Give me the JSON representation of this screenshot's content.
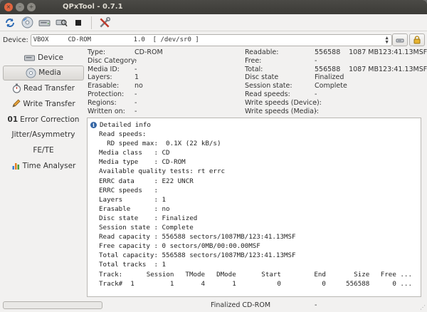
{
  "window": {
    "title": "QPxTool - 0.7.1"
  },
  "toolbar": {
    "icons": [
      "refresh-icon",
      "disc-icon",
      "drive-icon",
      "drive-search-icon",
      "stop-icon",
      "tools-icon"
    ]
  },
  "device": {
    "label": "Device:",
    "selected": "VBOX     CD-ROM           1.0  [ /dev/sr0 ]"
  },
  "sidebar": {
    "items": [
      {
        "label": "Device",
        "icon": "drive-icon"
      },
      {
        "label": "Media",
        "icon": "disc-icon"
      },
      {
        "label": "Read Transfer",
        "icon": "stopwatch-icon"
      },
      {
        "label": "Write Transfer",
        "icon": "pencil-icon"
      },
      {
        "label": "Error Correction",
        "prefix": "01"
      },
      {
        "label": "Jitter/Asymmetry"
      },
      {
        "label": "FE/TE"
      },
      {
        "label": "Time Analyser",
        "icon": "bar-chart-icon"
      }
    ],
    "active_index": 1
  },
  "info_left": [
    {
      "label": "Type:",
      "value": "CD-ROM"
    },
    {
      "label": "Disc Category:",
      "value": "-"
    },
    {
      "label": "Media ID:",
      "value": "-"
    },
    {
      "label": "Layers:",
      "value": "1"
    },
    {
      "label": "Erasable:",
      "value": "no"
    },
    {
      "label": "Protection:",
      "value": "-"
    },
    {
      "label": "Regions:",
      "value": "-"
    },
    {
      "label": "Written on:",
      "value": "-"
    }
  ],
  "info_right": [
    {
      "label": "Readable:",
      "value": "556588",
      "size": "1087 MB",
      "time": "123:41.13MSF"
    },
    {
      "label": "Free:",
      "value": "-",
      "size": "",
      "time": ""
    },
    {
      "label": "Total:",
      "value": "556588",
      "size": "1087 MB",
      "time": "123:41.13MSF"
    },
    {
      "label": "Disc state",
      "value": "Finalized",
      "size": "",
      "time": ""
    },
    {
      "label": "Session state:",
      "value": "Complete",
      "size": "",
      "time": ""
    },
    {
      "label": "Read speeds:",
      "value": "-",
      "size": "",
      "time": ""
    },
    {
      "label": "Write speeds (Device):",
      "value": "-",
      "size": "",
      "time": ""
    },
    {
      "label": "Write speeds (Media):",
      "value": "-",
      "size": "",
      "time": ""
    }
  ],
  "detail": {
    "header": "Detailed info",
    "lines": [
      "Read speeds:",
      "  RD speed max:  0.1X (22 kB/s)",
      "Media class   : CD",
      "Media type    : CD-ROM",
      "Available quality tests: rt errc",
      "ERRC data     : E22 UNCR",
      "ERRC speeds   :",
      "Layers        : 1",
      "Erasable      : no",
      "Disc state    : Finalized",
      "Session state : Complete",
      "Read capacity : 556588 sectors/1087MB/123:41.13MSF",
      "Free capacity : 0 sectors/0MB/00:00.00MSF",
      "Total capacity: 556588 sectors/1087MB/123:41.13MSF",
      "Total tracks  : 1"
    ],
    "track_headers": [
      "Track:",
      "Session",
      "TMode",
      "DMode",
      "Start",
      "End",
      "Size",
      "Free ..."
    ],
    "track_rows": [
      [
        "Track#",
        "1",
        "1",
        "4",
        "1",
        "0",
        "0",
        "556588",
        "0 ..."
      ]
    ]
  },
  "status": {
    "progress": 0,
    "text": "Finalized CD-ROM",
    "extra": "-"
  }
}
